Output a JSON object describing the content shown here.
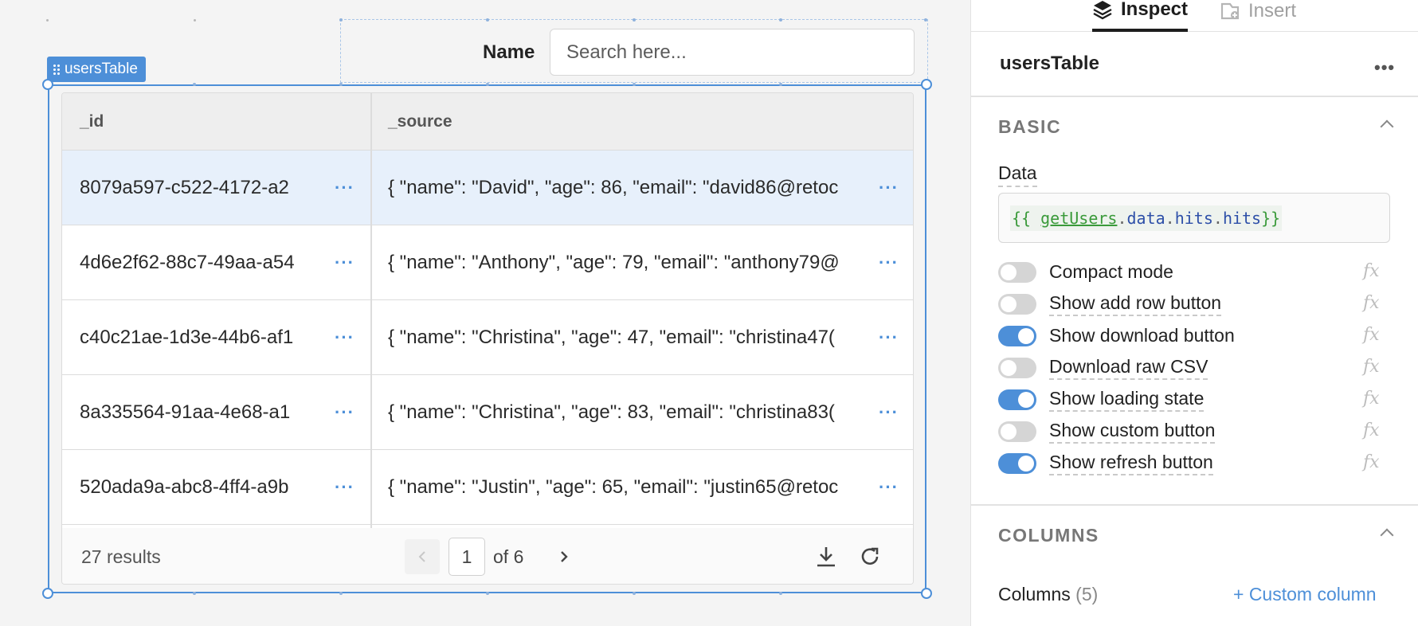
{
  "component": {
    "name": "usersTable"
  },
  "search": {
    "label": "Name",
    "placeholder": "Search here..."
  },
  "table": {
    "headers": [
      "_id",
      "_source"
    ],
    "rows": [
      {
        "id": "8079a597-c522-4172-a2",
        "source": "{ \"name\": \"David\", \"age\": 86, \"email\": \"david86@retoc"
      },
      {
        "id": "4d6e2f62-88c7-49aa-a54",
        "source": "{ \"name\": \"Anthony\", \"age\": 79, \"email\": \"anthony79@"
      },
      {
        "id": "c40c21ae-1d3e-44b6-af1",
        "source": "{ \"name\": \"Christina\", \"age\": 47, \"email\": \"christina47("
      },
      {
        "id": "8a335564-91aa-4e68-a1",
        "source": "{ \"name\": \"Christina\", \"age\": 83, \"email\": \"christina83("
      },
      {
        "id": "520ada9a-abc8-4ff4-a9b",
        "source": "{ \"name\": \"Justin\", \"age\": 65, \"email\": \"justin65@retoc"
      }
    ],
    "selected_row": 0,
    "footer": {
      "results": "27 results",
      "page": "1",
      "of_label": "of 6"
    }
  },
  "panel": {
    "tabs": [
      {
        "label": "Inspect",
        "active": true
      },
      {
        "label": "Insert",
        "active": false
      }
    ],
    "component_name": "usersTable",
    "basic": {
      "title": "BASIC",
      "data_label": "Data",
      "data_code": {
        "open": "{{ ",
        "query": "getUsers",
        "p1": "data",
        "p2": "hits",
        "p3": "hits",
        "close": "}}"
      }
    },
    "toggles": [
      {
        "label": "Compact mode",
        "on": false
      },
      {
        "label": "Show add row button",
        "on": false
      },
      {
        "label": "Show download button",
        "on": true
      },
      {
        "label": "Download raw CSV",
        "on": false
      },
      {
        "label": "Show loading state",
        "on": true
      },
      {
        "label": "Show custom button",
        "on": false
      },
      {
        "label": "Show refresh button",
        "on": true
      }
    ],
    "fx_label": "fx",
    "columns": {
      "title": "COLUMNS",
      "label": "Columns",
      "count": "(5)",
      "custom_button": "+ Custom column"
    }
  },
  "colors": {
    "accent": "#4d8fd8",
    "selected_row": "#e7f0fb",
    "code_green": "#3a9a3a",
    "code_blue": "#2d4fa8"
  }
}
